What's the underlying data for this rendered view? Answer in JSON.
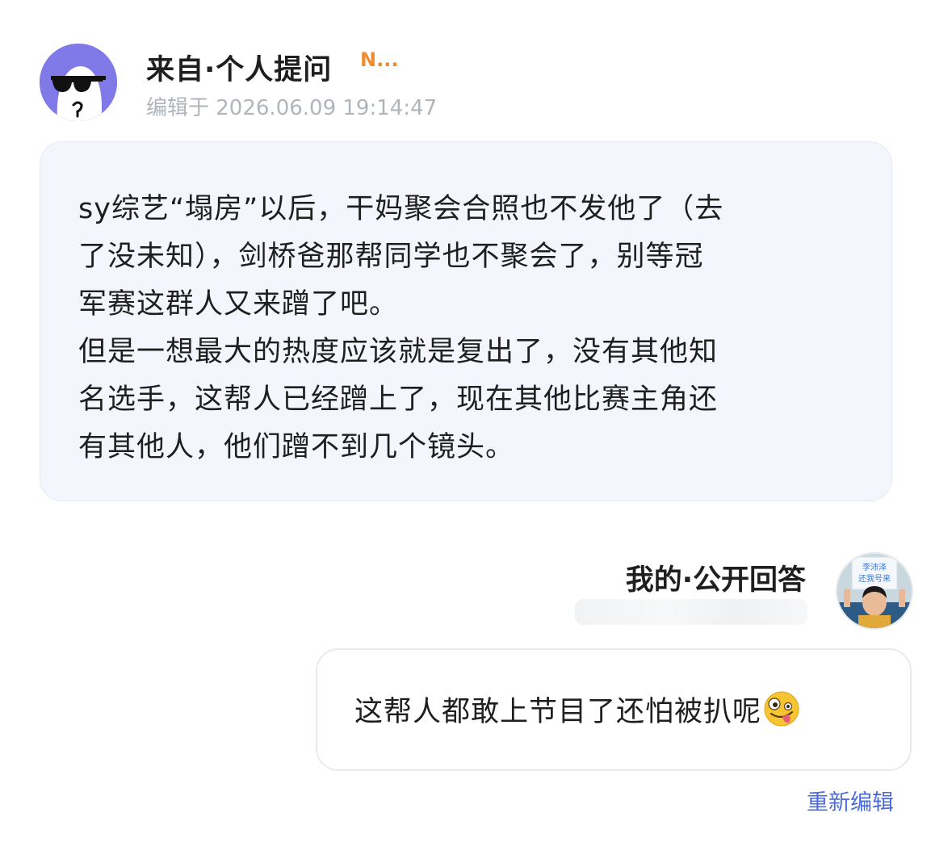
{
  "question": {
    "avatar_icon": "sunglasses-ghost-avatar",
    "title": "来自·个人提问",
    "badge": "N...",
    "timestamp": "编辑于 2026.06.09 19:14:47",
    "lines": [
      "sy综艺“塌房”以后，干妈聚会合照也不发他了（去",
      "了没未知），剑桥爸那帮同学也不聚会了，别等冠",
      "军赛这群人又来蹭了吧。",
      "但是一想最大的热度应该就是复出了，没有其他知",
      "名选手，这帮人已经蹭上了，现在其他比赛主角还",
      "有其他人，他们蹭不到几个镜头。"
    ]
  },
  "answer": {
    "title": "我的·公开回答",
    "avatar_icon": "user-photo-avatar",
    "avatar_sign_line1": "李沛泽",
    "avatar_sign_line2": "还我号来",
    "text": "这帮人都敢上节目了还怕被扒呢",
    "emoji_icon": "zany-face-emoji"
  },
  "actions": {
    "reedit_label": "重新编辑"
  },
  "colors": {
    "avatar_bg": "#7f7ae8",
    "badge": "#f08c2e",
    "link": "#4b6bdc",
    "question_bubble": "#f3f7fd"
  }
}
